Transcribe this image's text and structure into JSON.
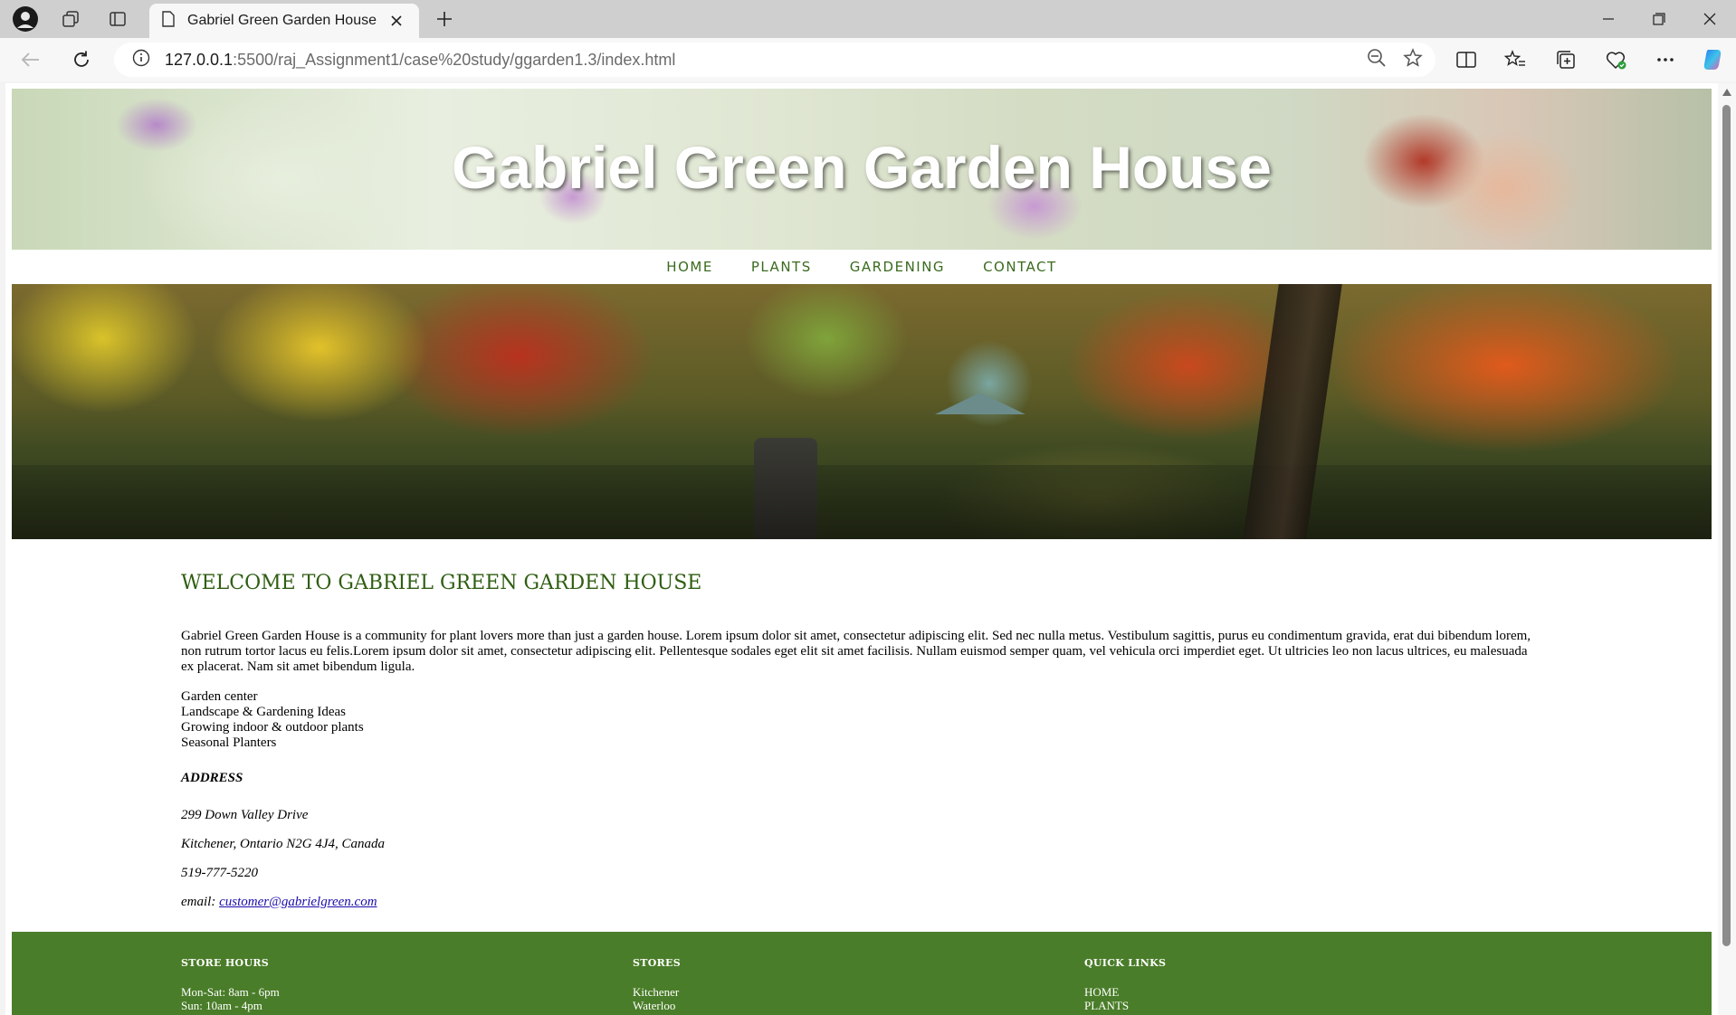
{
  "browser": {
    "tab_title": "Gabriel Green Garden House",
    "url_host": "127.0.0.1",
    "url_rest": ":5500/raj_Assignment1/case%20study/ggarden1.3/index.html"
  },
  "site": {
    "title": "Gabriel Green Garden House",
    "nav": [
      "HOME",
      "PLANTS",
      "GARDENING",
      "CONTACT"
    ]
  },
  "main": {
    "heading": "WELCOME TO GABRIEL GREEN GARDEN HOUSE",
    "intro": "Gabriel Green Garden House is a community for plant lovers more than just a garden house. Lorem ipsum dolor sit amet, consectetur adipiscing elit. Sed nec nulla metus. Vestibulum sagittis, purus eu condimentum gravida, erat dui bibendum lorem, non rutrum tortor lacus eu felis.Lorem ipsum dolor sit amet, consectetur adipiscing elit. Pellentesque sodales eget elit sit amet facilisis. Nullam euismod semper quam, vel vehicula orci imperdiet eget. Ut ultricies leo non lacus ultrices, eu malesuada ex placerat. Nam sit amet bibendum ligula.",
    "services": [
      "Garden center",
      "Landscape & Gardening Ideas",
      "Growing indoor & outdoor plants",
      "Seasonal Planters"
    ],
    "address_heading": "ADDRESS",
    "street": "299 Down Valley Drive",
    "city": "Kitchener, Ontario N2G 4J4, Canada",
    "phone": "519-777-5220",
    "email_label": "email:",
    "email": "customer@gabrielgreen.com"
  },
  "footer": {
    "hours_heading": "STORE HOURS",
    "hours": [
      "Mon-Sat: 8am - 6pm",
      "Sun: 10am - 4pm"
    ],
    "stores_heading": "STORES",
    "stores": [
      "Kitchener",
      "Waterloo"
    ],
    "links_heading": "QUICK LINKS",
    "links": [
      "HOME",
      "PLANTS"
    ]
  },
  "colors": {
    "brand_green": "#4a7d29",
    "heading_green": "#2f5e12",
    "nav_green": "#3a6b1e"
  }
}
